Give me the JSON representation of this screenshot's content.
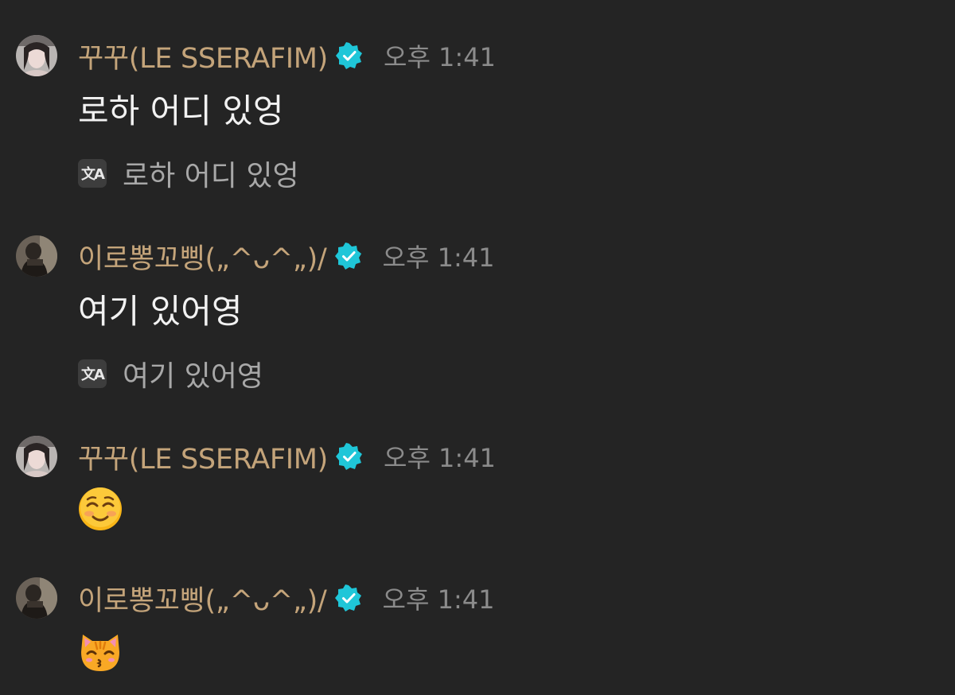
{
  "messages": [
    {
      "sender": "꾸꾸(LE SSERAFIM)",
      "time": "오후 1:41",
      "text": "로하 어디 있엉",
      "translation": "로하 어디 있엉"
    },
    {
      "sender": "이로뽕꼬삥(„^ᴗ^„)/",
      "time": "오후 1:41",
      "text": "여기 있어영",
      "translation": "여기 있어영"
    },
    {
      "sender": "꾸꾸(LE SSERAFIM)",
      "time": "오후 1:41",
      "emoji": "smiling-face-with-smiling-eyes"
    },
    {
      "sender": "이로뽕꼬삥(„^ᴗ^„)/",
      "time": "오후 1:41",
      "emoji": "kissing-cat"
    }
  ],
  "translate_icon_label": "文A",
  "icons": {
    "verified": "verified-badge-icon",
    "translate": "translate-icon"
  },
  "colors": {
    "background": "#242424",
    "sender_name": "#c4a47a",
    "verified_badge": "#1fc6d8",
    "time": "#8b8b8b",
    "message_text": "#f2f2f2",
    "translation_text": "#a8a8a8"
  }
}
